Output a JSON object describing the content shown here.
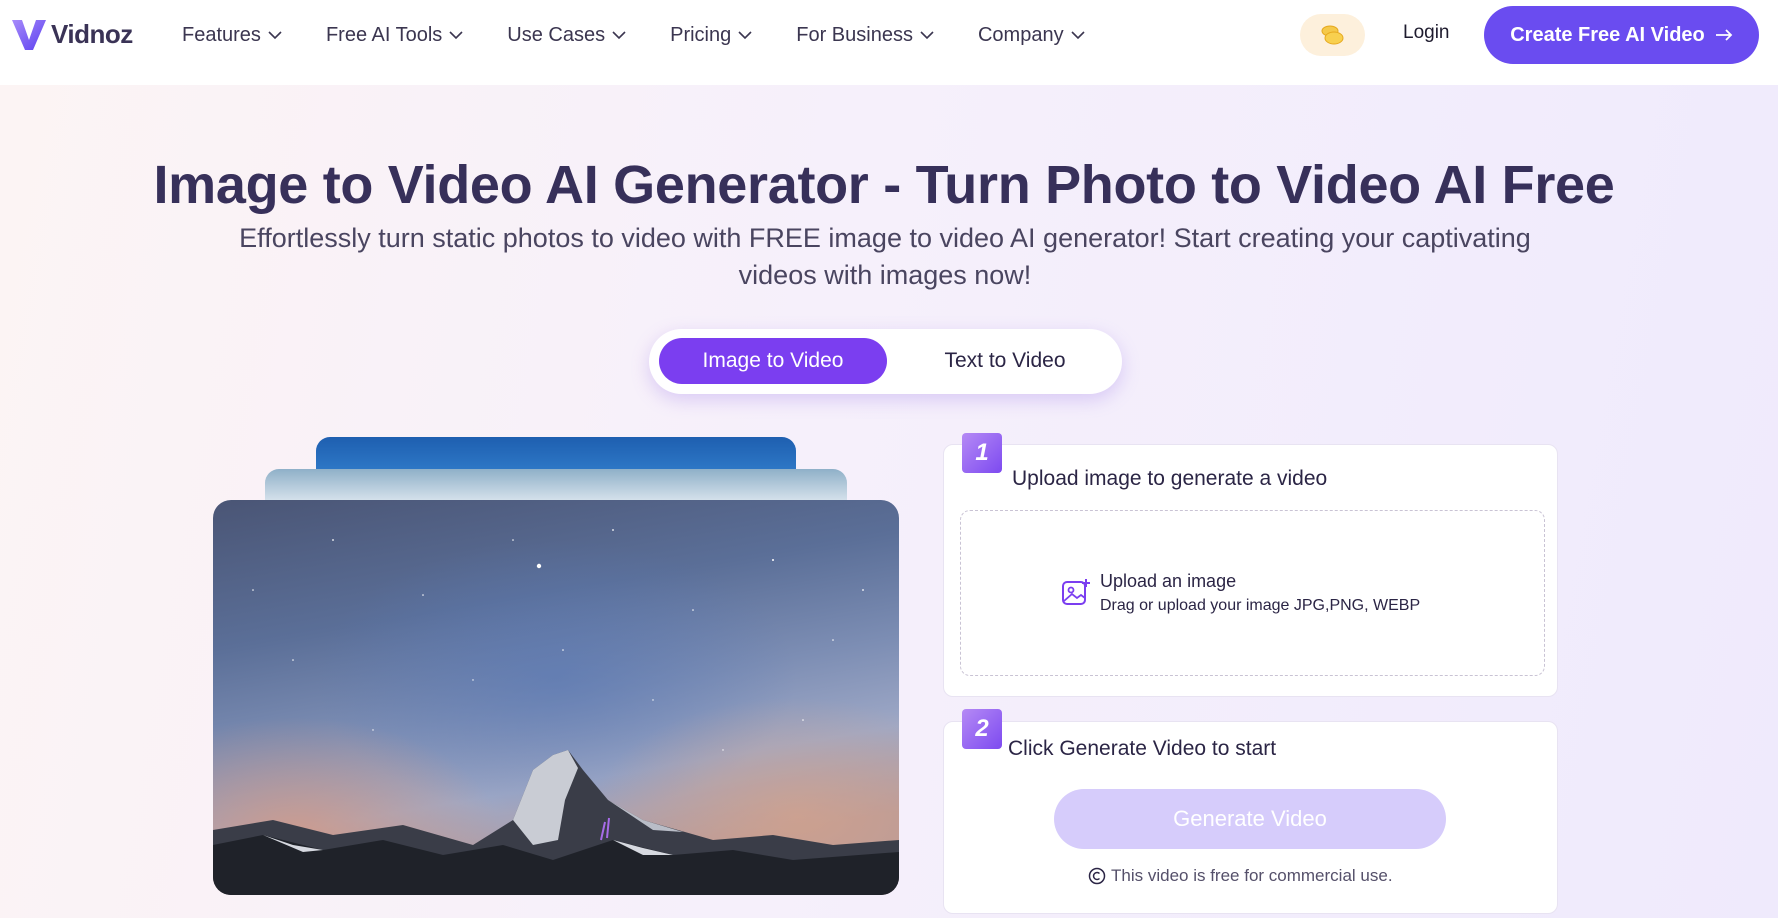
{
  "nav": {
    "logo_text": "Vidnoz",
    "menu": [
      {
        "label": "Features"
      },
      {
        "label": "Free AI Tools"
      },
      {
        "label": "Use Cases"
      },
      {
        "label": "Pricing"
      },
      {
        "label": "For Business"
      },
      {
        "label": "Company"
      }
    ],
    "login_label": "Login",
    "cta_label": "Create Free AI Video"
  },
  "hero": {
    "title": "Image to Video AI Generator - Turn Photo to Video AI Free",
    "subtitle": "Effortlessly turn static photos to video with FREE image to video AI generator! Start creating your captivating videos with images now!"
  },
  "tabs": {
    "active": "Image to Video",
    "inactive": "Text to Video"
  },
  "steps": {
    "step1": {
      "number": "1",
      "label": "Upload image to generate a video",
      "upload_title": "Upload an image",
      "upload_hint": "Drag or upload your image JPG,PNG, WEBP"
    },
    "step2": {
      "number": "2",
      "label": "Click Generate Video to start",
      "button_label": "Generate Video",
      "note": "This video is free for commercial use."
    }
  },
  "colors": {
    "brand": "#6a4cf0",
    "tab_active": "#7b3ef0",
    "generate_disabled": "#d6ccfb",
    "title": "#37305a"
  }
}
